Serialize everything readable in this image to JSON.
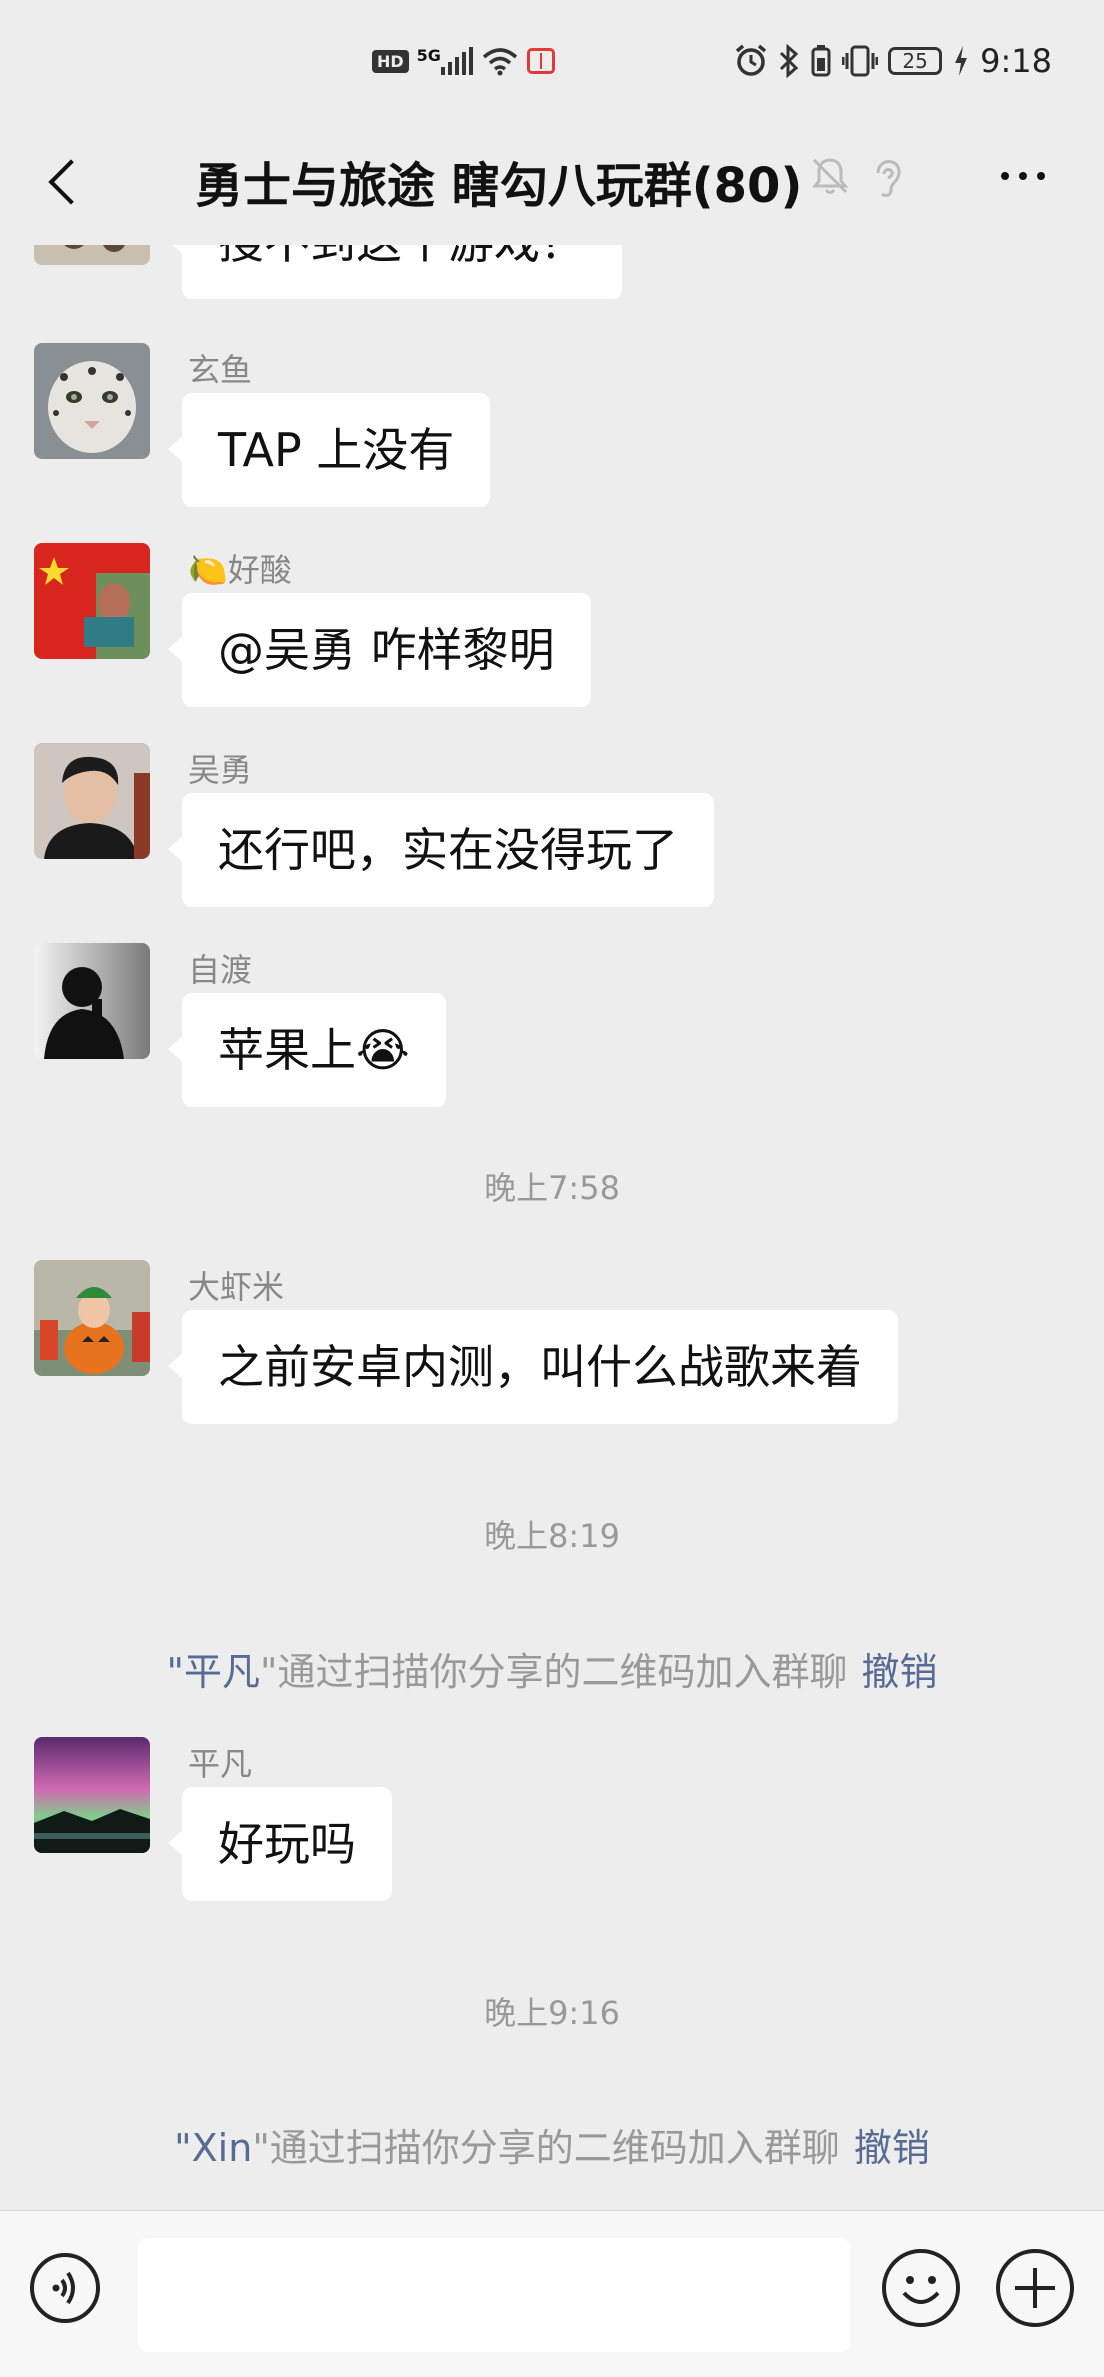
{
  "status_bar": {
    "hd": "HD",
    "network": "5G",
    "battery": "25",
    "time": "9:18",
    "icons": [
      "hd-icon",
      "signal-icon",
      "wifi-icon",
      "red-book-icon",
      "alarm-icon",
      "bluetooth-icon",
      "battery-saver-icon",
      "vibrate-icon",
      "battery-icon",
      "charging-icon"
    ]
  },
  "header": {
    "title": "勇士与旅途 瞎勾八玩群(80)",
    "icons": [
      "back-icon",
      "mute-bell-icon",
      "earpiece-icon",
      "more-icon"
    ]
  },
  "messages": [
    {
      "type": "msg",
      "nick": "",
      "text": "搜不到这个游戏？"
    },
    {
      "type": "msg",
      "nick": "玄鱼",
      "text": "TAP 上没有",
      "avatar": "snow-leopard"
    },
    {
      "type": "msg",
      "nick": "🍋好酸",
      "text": "@吴勇  咋样黎明",
      "avatar": "flag"
    },
    {
      "type": "msg",
      "nick": "吴勇",
      "text": "还行吧，实在没得玩了",
      "avatar": "man-portrait"
    },
    {
      "type": "msg",
      "nick": "自渡",
      "text": "苹果上😭",
      "avatar": "silhouette"
    },
    {
      "type": "time",
      "text": "晚上7:58"
    },
    {
      "type": "msg",
      "nick": "大虾米",
      "text": "之前安卓内测，叫什么战歌来着",
      "avatar": "pumpkin-child"
    },
    {
      "type": "time",
      "text": "晚上8:19"
    },
    {
      "type": "sys",
      "name": "平凡",
      "pre": "\"",
      "post": "\"通过扫描你分享的二维码加入群聊",
      "action": "撤销"
    },
    {
      "type": "msg",
      "nick": "平凡",
      "text": "好玩吗",
      "avatar": "aurora"
    },
    {
      "type": "time",
      "text": "晚上9:16"
    },
    {
      "type": "sys",
      "name": "Xin",
      "pre": "\"",
      "post": "\"通过扫描你分享的二维码加入群聊",
      "action": "撤销"
    }
  ],
  "input_bar": {
    "icons": [
      "voice-icon",
      "emoji-icon",
      "plus-icon"
    ],
    "value": ""
  },
  "colors": {
    "background": "#ededed",
    "bubble": "#ffffff",
    "link": "#576b95",
    "muted_text": "#999999"
  }
}
